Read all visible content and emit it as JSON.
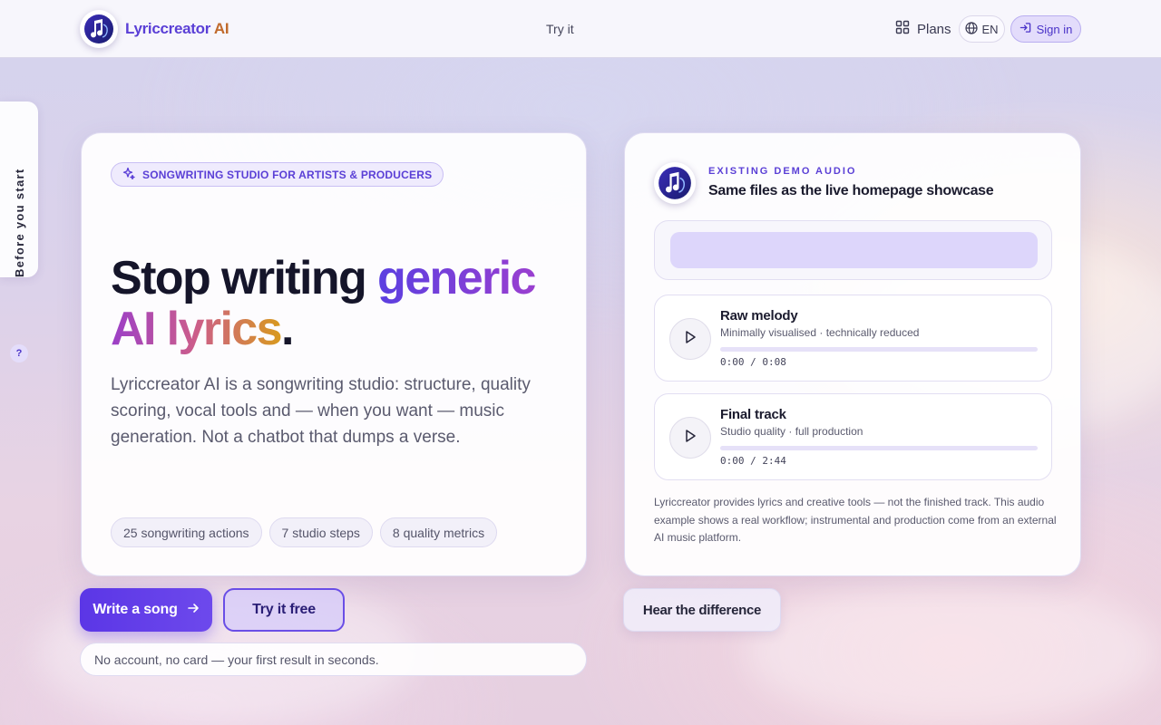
{
  "header": {
    "brand_part1": "Lyriccreator",
    "brand_part2": " AI",
    "nav_try": "Try it",
    "plans": "Plans",
    "lang": "EN",
    "signin": "Sign in"
  },
  "side_tab": {
    "label": "Before you start",
    "help": "?"
  },
  "hero": {
    "tag": "SONGWRITING STUDIO FOR ARTISTS & PRODUCERS",
    "headline_a": "Stop writing ",
    "headline_b": "generic",
    "headline_c": "AI lyrics",
    "headline_d": ".",
    "lede": "Lyriccreator AI is a songwriting studio: structure, quality scoring, vocal tools and — when you want — music generation. Not a chatbot that dumps a verse.",
    "chips": [
      "25 songwriting actions",
      "7 studio steps",
      "8 quality metrics"
    ]
  },
  "cta": {
    "primary": "Write a song",
    "secondary": "Try it free",
    "note": "No account, no card — your first result in seconds.",
    "hear": "Hear the difference"
  },
  "demo": {
    "kicker": "EXISTING DEMO AUDIO",
    "title": "Same files as the live homepage showcase",
    "tracks": [
      {
        "name": "Raw melody",
        "subtitle": "Minimally visualised · technically reduced",
        "time": "0:00 / 0:08",
        "progress": 0
      },
      {
        "name": "Final track",
        "subtitle": "Studio quality · full production",
        "time": "0:00 / 2:44",
        "progress": 0
      }
    ],
    "footnote": "Lyriccreator provides lyrics and creative tools — not the finished track. This audio example shows a real workflow; instrumental and production come from an external AI music platform."
  },
  "colors": {
    "accent": "#5b36e6",
    "brand_purple": "#5a3fd6",
    "brand_orange": "#c06a2c"
  },
  "icons": {
    "logo": "music-note-head-icon",
    "plans": "grid-icon",
    "lang": "globe-icon",
    "signin": "sign-in-icon",
    "tag": "sparkle-icon",
    "primary": "arrow-right-icon",
    "play": "play-icon"
  }
}
